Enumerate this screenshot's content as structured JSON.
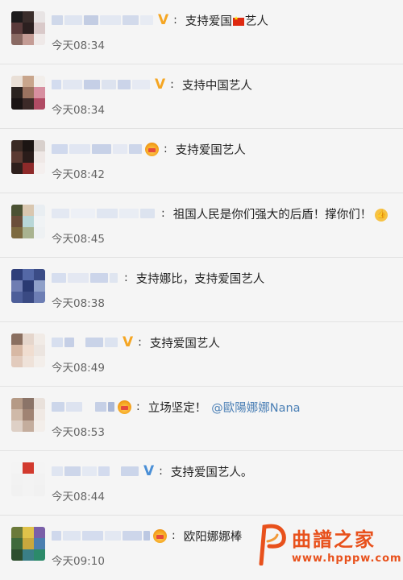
{
  "comments": [
    {
      "text": "支持爱国",
      "after_flag": "艺人",
      "time": "今天08:34",
      "badge": "V",
      "badge_color": "#f5a623",
      "has_flag": true
    },
    {
      "text": "支持中国艺人",
      "time": "今天08:34",
      "badge": "V",
      "badge_color": "#f5a623"
    },
    {
      "text": "支持爱国艺人",
      "time": "今天08:42",
      "badge": "vip-crown"
    },
    {
      "text": "祖国人民是你们强大的后盾！撑你们！",
      "time": "今天08:45",
      "badge": "none",
      "has_thumb": true
    },
    {
      "text": "支持娜比，支持爱国艺人",
      "time": "今天08:38",
      "badge": "none"
    },
    {
      "text": "支持爱国艺人",
      "time": "今天08:49",
      "badge": "V",
      "badge_color": "#f5a623"
    },
    {
      "text": "立场坚定！",
      "mention": "@歐陽娜娜Nana",
      "time": "今天08:53",
      "badge": "vip-crown"
    },
    {
      "text": "支持爱国艺人。",
      "time": "今天08:44",
      "badge": "V",
      "badge_color": "#4a8fd6"
    },
    {
      "text": "欧阳娜娜棒",
      "time": "今天09:10",
      "badge": "vip-crown"
    }
  ],
  "watermark": {
    "title": "曲譜之家",
    "url": "www.hpppw.com",
    "color": "#e8511c"
  }
}
